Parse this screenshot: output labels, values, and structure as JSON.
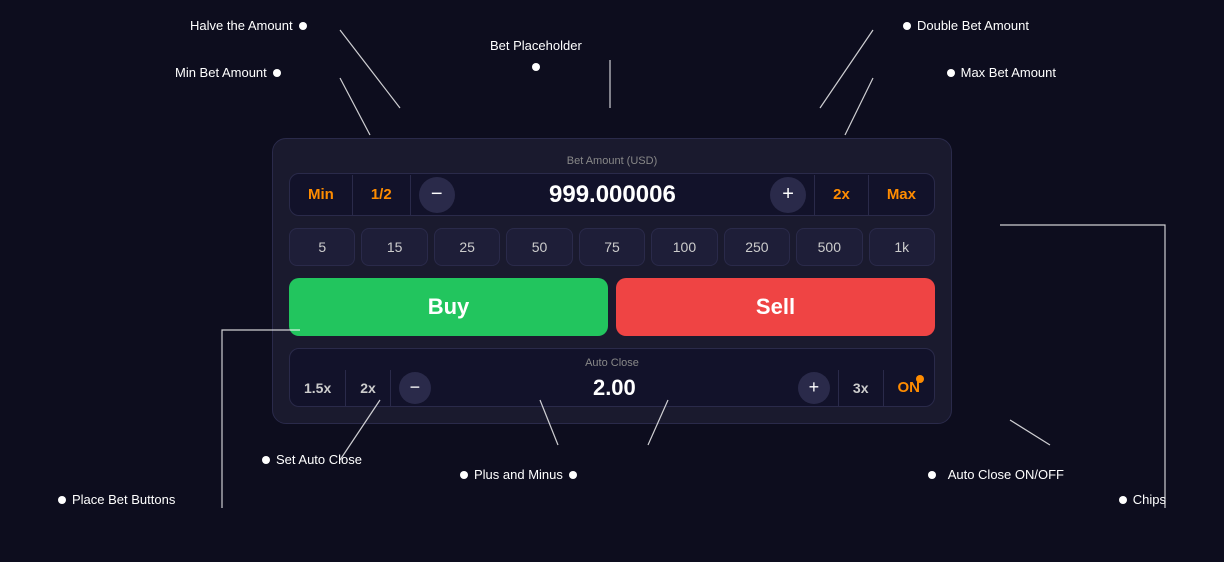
{
  "annotations": {
    "halve_amount": "Halve the Amount",
    "min_bet_amount": "Min Bet Amount",
    "bet_placeholder": "Bet Placeholder",
    "double_bet_amount": "Double Bet Amount",
    "max_bet_amount": "Max Bet Amount",
    "chips": "Chips",
    "auto_close_onoff": "Auto Close ON/OFF",
    "place_bet_buttons": "Place Bet Buttons",
    "set_auto_close": "Set Auto Close",
    "plus_and_minus": "Plus and Minus"
  },
  "widget": {
    "bet_amount_label": "Bet Amount (USD)",
    "bet_min": "Min",
    "bet_half": "1/2",
    "bet_value": "999.000006",
    "bet_2x": "2x",
    "bet_max": "Max",
    "chips": [
      "5",
      "15",
      "25",
      "50",
      "75",
      "100",
      "250",
      "500",
      "1k"
    ],
    "buy_label": "Buy",
    "sell_label": "Sell",
    "auto_close_label": "Auto Close",
    "ac_15x": "1.5x",
    "ac_2x": "2x",
    "ac_minus": "—",
    "ac_value": "2.00",
    "ac_plus": "+",
    "ac_3x": "3x",
    "ac_on": "ON"
  }
}
